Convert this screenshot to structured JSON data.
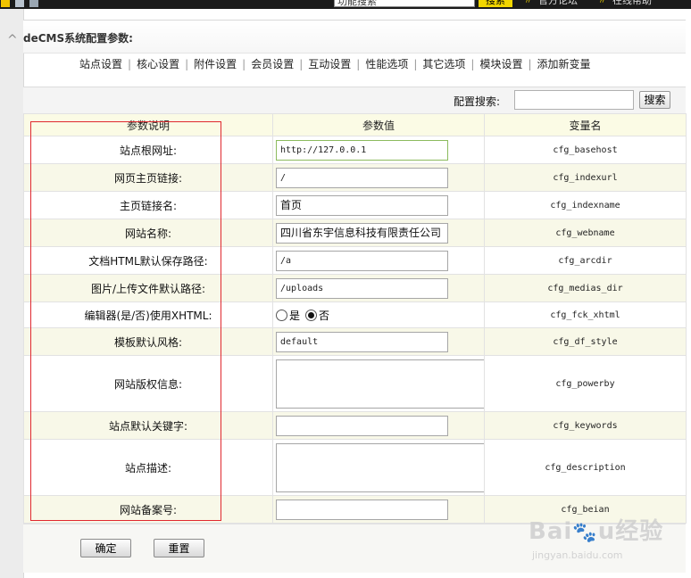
{
  "topbar": {
    "search_value": "功能搜索",
    "search_button": "搜索",
    "links": [
      "官方论坛",
      "在线帮助"
    ],
    "colors": {
      "bar": "#1b1b1b",
      "accent": "#f2d600",
      "squares": [
        "#f2c400",
        "#b9c3ce",
        "#9aa6b2"
      ]
    }
  },
  "page": {
    "title": "deCMS系统配置参数:"
  },
  "nav": {
    "items": [
      "站点设置",
      "核心设置",
      "附件设置",
      "会员设置",
      "互动设置",
      "性能选项",
      "其它选项",
      "模块设置",
      "添加新变量"
    ]
  },
  "config_search": {
    "label": "配置搜索:",
    "value": "",
    "button": "搜索"
  },
  "table": {
    "headers": [
      "参数说明",
      "参数值",
      "变量名"
    ],
    "rows": [
      {
        "desc": "站点根网址:",
        "type": "text",
        "value": "http://127.0.0.1",
        "var": "cfg_basehost"
      },
      {
        "desc": "网页主页链接:",
        "type": "text",
        "value": "/",
        "var": "cfg_indexurl"
      },
      {
        "desc": "主页链接名:",
        "type": "text",
        "value": "首页",
        "var": "cfg_indexname"
      },
      {
        "desc": "网站名称:",
        "type": "text",
        "value": "四川省东宇信息科技有限责任公司",
        "var": "cfg_webname"
      },
      {
        "desc": "文档HTML默认保存路径:",
        "type": "text",
        "value": "/a",
        "var": "cfg_arcdir"
      },
      {
        "desc": "图片/上传文件默认路径:",
        "type": "text",
        "value": "/uploads",
        "var": "cfg_medias_dir"
      },
      {
        "desc": "编辑器(是/否)使用XHTML:",
        "type": "radio",
        "options": [
          "是",
          "否"
        ],
        "selected": "否",
        "var": "cfg_fck_xhtml"
      },
      {
        "desc": "模板默认风格:",
        "type": "text",
        "value": "default",
        "var": "cfg_df_style"
      },
      {
        "desc": "网站版权信息:",
        "type": "textarea",
        "value": "",
        "var": "cfg_powerby"
      },
      {
        "desc": "站点默认关键字:",
        "type": "text",
        "value": "",
        "var": "cfg_keywords"
      },
      {
        "desc": "站点描述:",
        "type": "textarea",
        "value": "",
        "var": "cfg_description"
      },
      {
        "desc": "网站备案号:",
        "type": "text",
        "value": "",
        "var": "cfg_beian"
      }
    ]
  },
  "footer": {
    "confirm": "确定",
    "reset": "重置"
  },
  "highlight_color": "#e0282f",
  "watermark": {
    "logo_text": "Baidu经验",
    "url": "jingyan.baidu.com"
  }
}
